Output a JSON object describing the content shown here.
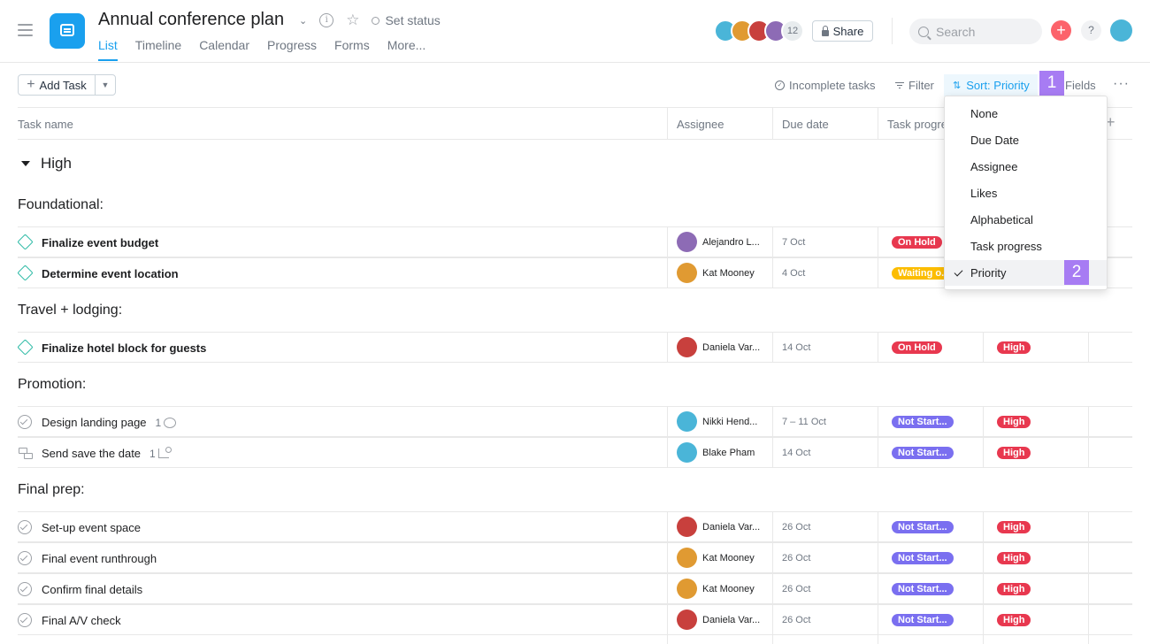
{
  "colors": {
    "accent": "#1aa0ee",
    "on_hold": "#e8384f",
    "waiting": "#fcbd01",
    "not_started": "#7a6ff0",
    "high": "#e8384f",
    "milestone": "#25b8a2",
    "annotation": "#a77cf3"
  },
  "header": {
    "title": "Annual conference plan",
    "set_status": "Set status",
    "tabs": [
      "List",
      "Timeline",
      "Calendar",
      "Progress",
      "Forms",
      "More..."
    ],
    "member_count": "12",
    "share_label": "Share",
    "search_placeholder": "Search",
    "help_label": "?"
  },
  "toolbar": {
    "add_task_label": "Add Task",
    "incomplete_label": "Incomplete tasks",
    "filter_label": "Filter",
    "sort_label": "Sort: Priority",
    "fields_label": "Fields",
    "more_label": "···"
  },
  "annotations": {
    "badge1": "1",
    "badge2": "2"
  },
  "columns": [
    "Task name",
    "Assignee",
    "Due date",
    "Task progre"
  ],
  "group": {
    "label": "High"
  },
  "sections": [
    {
      "title": "Foundational:"
    },
    {
      "title": "Travel + lodging:"
    },
    {
      "title": "Promotion:"
    },
    {
      "title": "Final prep:"
    }
  ],
  "tasks": [
    {
      "name": "Finalize event budget",
      "assignee": "Alejandro L...",
      "due": "7 Oct",
      "progress": "On Hold",
      "priority": ""
    },
    {
      "name": "Determine event location",
      "assignee": "Kat Mooney",
      "due": "4 Oct",
      "progress": "Waiting o...",
      "priority": ""
    },
    {
      "name": "Finalize hotel block for guests",
      "assignee": "Daniela Var...",
      "due": "14 Oct",
      "progress": "On Hold",
      "priority": "High"
    },
    {
      "name": "Design landing page",
      "count": "1",
      "assignee": "Nikki Hend...",
      "due": "7 – 11 Oct",
      "progress": "Not Start...",
      "priority": "High"
    },
    {
      "name": "Send save the date",
      "count": "1",
      "assignee": "Blake Pham",
      "due": "14 Oct",
      "progress": "Not Start...",
      "priority": "High"
    },
    {
      "name": "Set-up event space",
      "assignee": "Daniela Var...",
      "due": "26 Oct",
      "progress": "Not Start...",
      "priority": "High"
    },
    {
      "name": "Final event runthrough",
      "assignee": "Kat Mooney",
      "due": "26 Oct",
      "progress": "Not Start...",
      "priority": "High"
    },
    {
      "name": "Confirm final details",
      "assignee": "Kat Mooney",
      "due": "26 Oct",
      "progress": "Not Start...",
      "priority": "High"
    },
    {
      "name": "Final A/V check",
      "assignee": "Daniela Var...",
      "due": "26 Oct",
      "progress": "Not Start...",
      "priority": "High"
    }
  ],
  "sort_menu": {
    "items": [
      "None",
      "Due Date",
      "Assignee",
      "Likes",
      "Alphabetical",
      "Task progress",
      "Priority"
    ],
    "selected": "Priority"
  }
}
